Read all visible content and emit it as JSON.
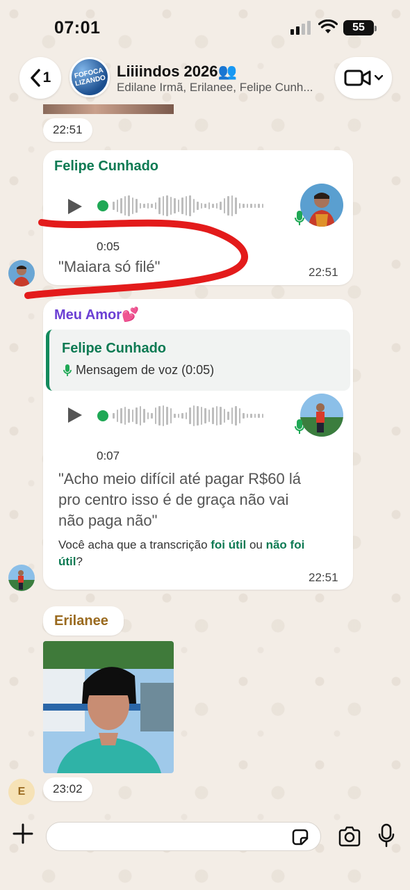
{
  "status_bar": {
    "time": "07:01",
    "battery": "55"
  },
  "header": {
    "back_count": "1",
    "group_avatar_text": "FOFOCA LIZANDO",
    "title": "Liiiindos 2026👥",
    "subtitle": "Edilane Irmã, Erilanee, Felipe Cunh..."
  },
  "messages": {
    "top_time": "22:51",
    "voice1": {
      "sender": "Felipe Cunhado",
      "sender_color": "#0d7a53",
      "duration": "0:05",
      "transcript": "\"Maiara só filé\"",
      "time": "22:51"
    },
    "voice2": {
      "sender": "Meu Amor💕",
      "sender_color": "#6b3fd4",
      "quote_sender": "Felipe Cunhado",
      "quote_text": "Mensagem de voz (0:05)",
      "duration": "0:07",
      "transcript_line1": "\"Acho meio difícil até pagar R$60 lá",
      "transcript_line2": "pro centro isso é de graça não vai",
      "transcript_line3": "não paga não\"",
      "feedback_prefix": "Você acha que a transcrição ",
      "feedback_useful": "foi útil",
      "feedback_mid": " ou ",
      "feedback_not_useful_1": "não foi",
      "feedback_not_useful_2": "útil",
      "feedback_suffix": "?",
      "time": "22:51"
    },
    "image_msg": {
      "sender": "Erilanee",
      "sender_color": "#9a6a1f",
      "avatar_letter": "E",
      "time": "23:02"
    }
  },
  "input": {
    "placeholder": ""
  },
  "colors": {
    "accent_green": "#1fa855",
    "annotation_red": "#e31b1b"
  }
}
